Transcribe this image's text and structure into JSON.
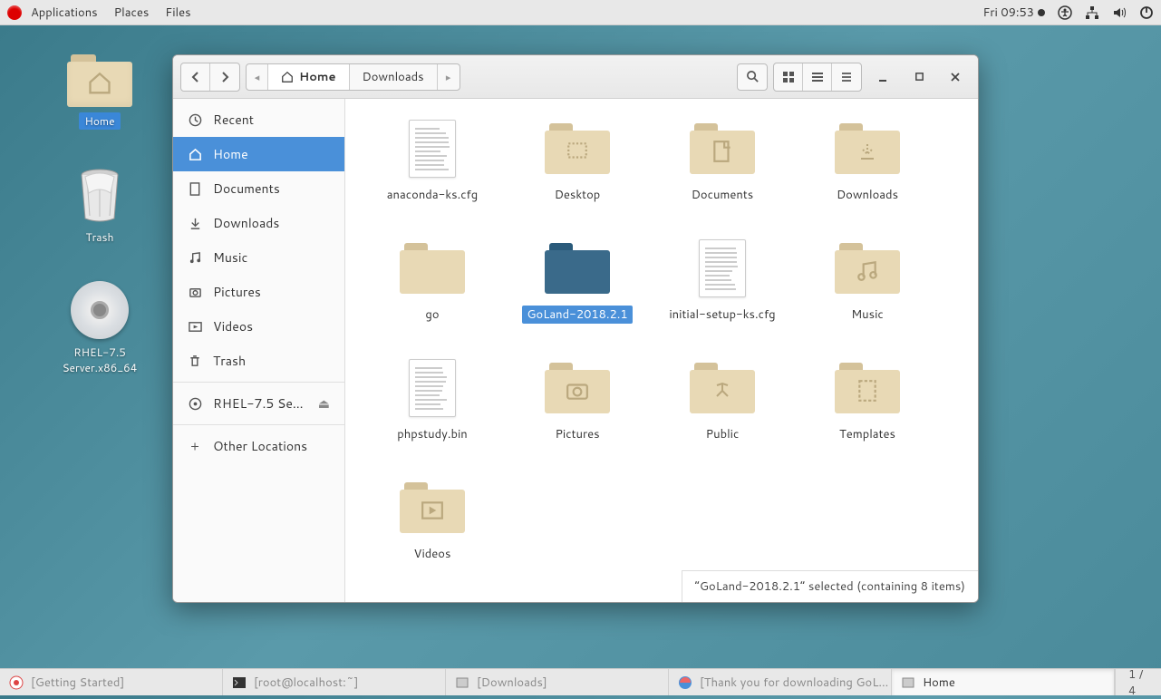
{
  "topbar": {
    "menus": [
      "Applications",
      "Places",
      "Files"
    ],
    "clock": "Fri 09:53"
  },
  "desktop": {
    "home_label": "Home",
    "trash_label": "Trash",
    "disc_label": "RHEL-7.5 Server.x86_64"
  },
  "window": {
    "path": {
      "home": "Home",
      "downloads": "Downloads"
    },
    "sidebar": {
      "recent": "Recent",
      "home": "Home",
      "documents": "Documents",
      "downloads": "Downloads",
      "music": "Music",
      "pictures": "Pictures",
      "videos": "Videos",
      "trash": "Trash",
      "device": "RHEL-7.5 Se...",
      "other": "Other Locations"
    },
    "files": [
      {
        "name": "anaconda-ks.cfg",
        "type": "doc"
      },
      {
        "name": "Desktop",
        "type": "folder",
        "glyph": "desktop"
      },
      {
        "name": "Documents",
        "type": "folder",
        "glyph": "doc"
      },
      {
        "name": "Downloads",
        "type": "folder",
        "glyph": "down"
      },
      {
        "name": "go",
        "type": "folder",
        "glyph": ""
      },
      {
        "name": "GoLand-2018.2.1",
        "type": "folder",
        "glyph": "",
        "selected": true
      },
      {
        "name": "initial-setup-ks.cfg",
        "type": "doc"
      },
      {
        "name": "Music",
        "type": "folder",
        "glyph": "music"
      },
      {
        "name": "phpstudy.bin",
        "type": "doc"
      },
      {
        "name": "Pictures",
        "type": "folder",
        "glyph": "camera"
      },
      {
        "name": "Public",
        "type": "folder",
        "glyph": "public"
      },
      {
        "name": "Templates",
        "type": "folder",
        "glyph": "template"
      },
      {
        "name": "Videos",
        "type": "folder",
        "glyph": "video"
      }
    ],
    "status": "“GoLand-2018.2.1” selected  (containing 8 items)"
  },
  "taskbar": {
    "tasks": [
      {
        "label": "[Getting Started]"
      },
      {
        "label": "[root@localhost:~]"
      },
      {
        "label": "[Downloads]"
      },
      {
        "label": "[Thank you for downloading GoL..."
      },
      {
        "label": "Home",
        "active": true
      }
    ],
    "workspace": "1 / 4"
  }
}
